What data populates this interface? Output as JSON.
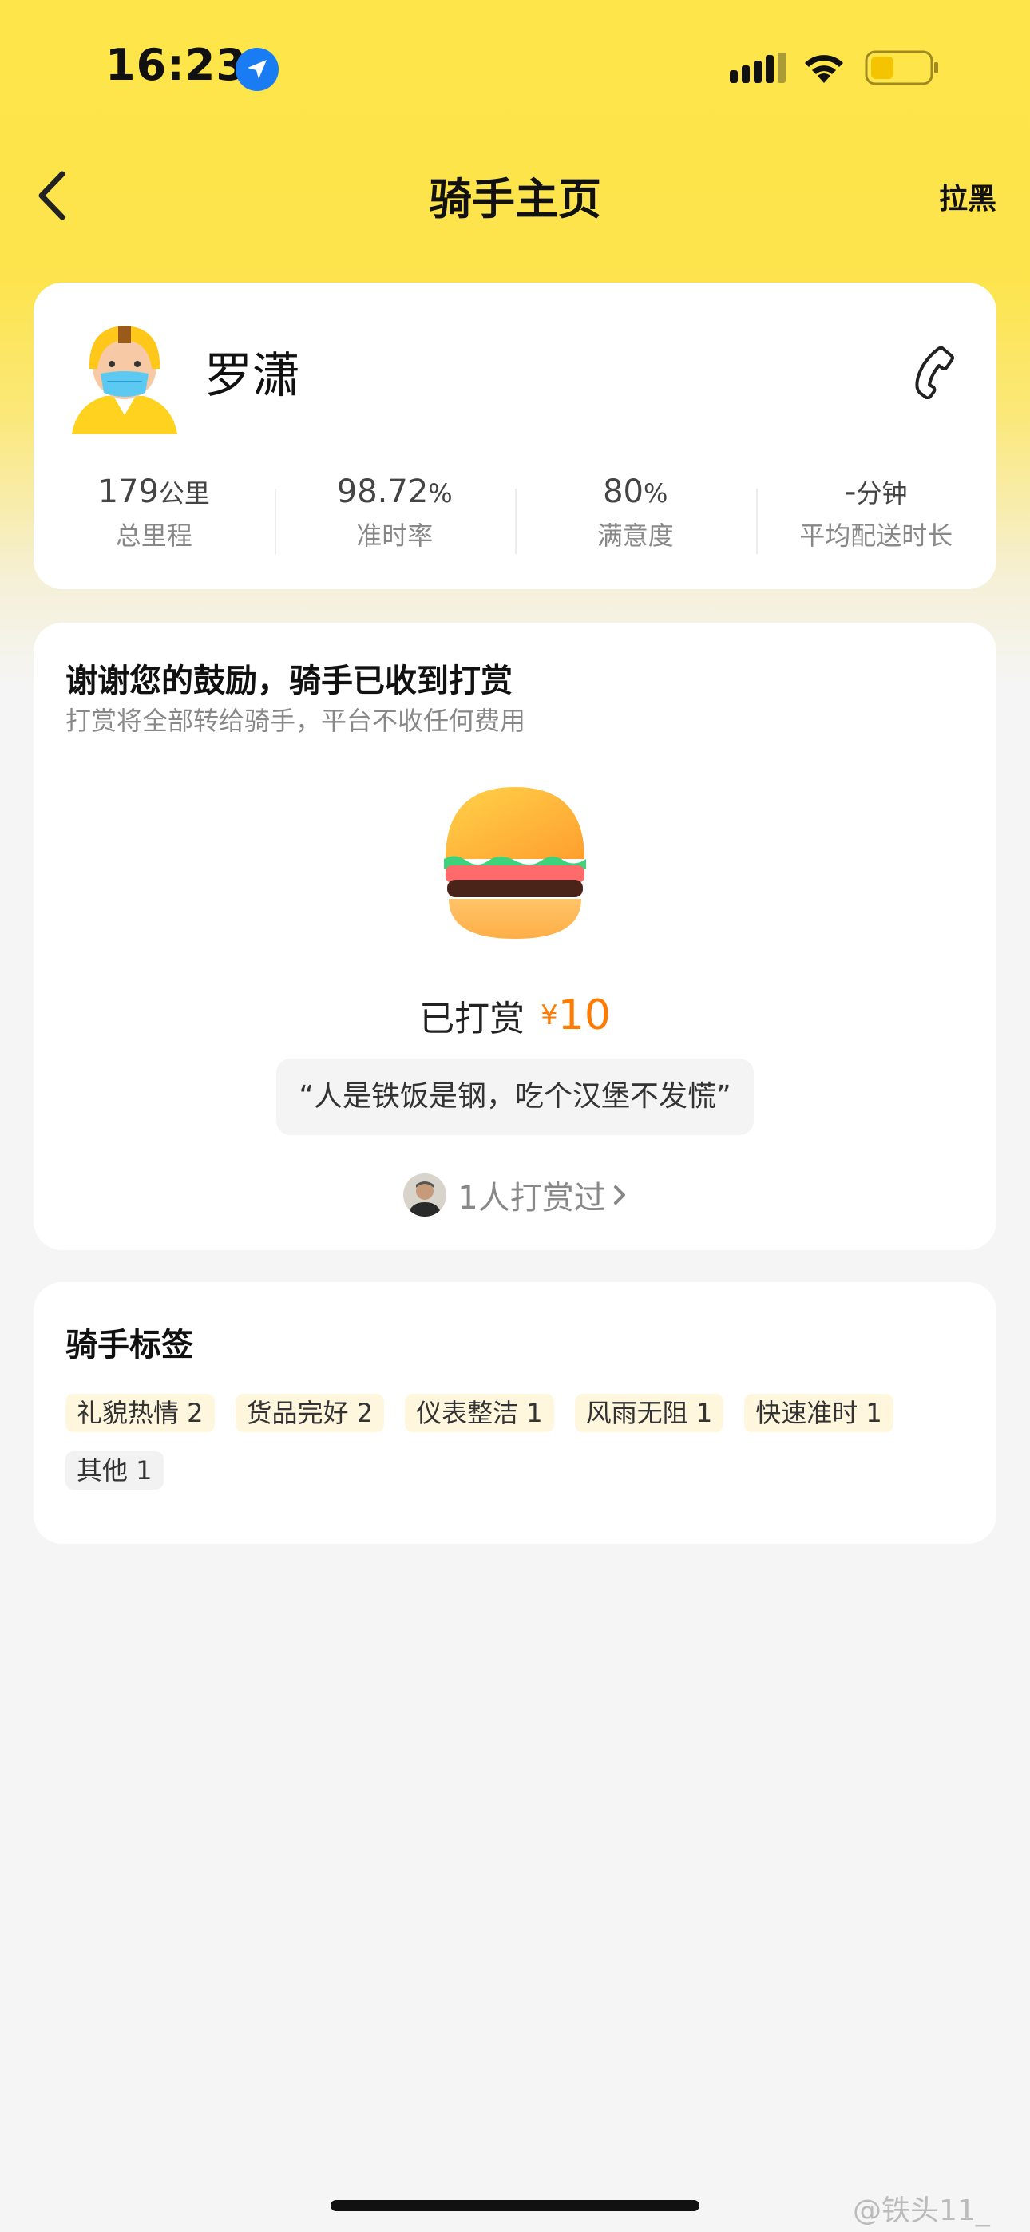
{
  "status_bar": {
    "time": "16:23"
  },
  "nav": {
    "title": "骑手主页",
    "block_label": "拉黑"
  },
  "rider": {
    "name": "罗潇",
    "stats": [
      {
        "value": "179",
        "unit": "公里",
        "label": "总里程"
      },
      {
        "value": "98.72",
        "unit": "%",
        "label": "准时率"
      },
      {
        "value": "80",
        "unit": "%",
        "label": "满意度"
      },
      {
        "value": "-",
        "unit": "分钟",
        "label": "平均配送时长"
      }
    ]
  },
  "tip": {
    "title": "谢谢您的鼓励，骑手已收到打赏",
    "subtitle": "打赏将全部转给骑手，平台不收任何费用",
    "amount_label": "已打赏",
    "currency": "¥",
    "amount": "10",
    "quote": "“人是铁饭是钢，吃个汉堡不发慌”",
    "tippers_text": "1人打赏过"
  },
  "tags": {
    "title": "骑手标签",
    "items": [
      {
        "label": "礼貌热情 2"
      },
      {
        "label": "货品完好 2"
      },
      {
        "label": "仪表整洁 1"
      },
      {
        "label": "风雨无阻 1"
      },
      {
        "label": "快速准时 1"
      },
      {
        "label": "其他 1"
      }
    ]
  },
  "watermark": "@铁头11_",
  "colors": {
    "brand_yellow": "#fde54a",
    "accent_orange": "#ff7a00",
    "location_blue": "#1a7cf2"
  }
}
